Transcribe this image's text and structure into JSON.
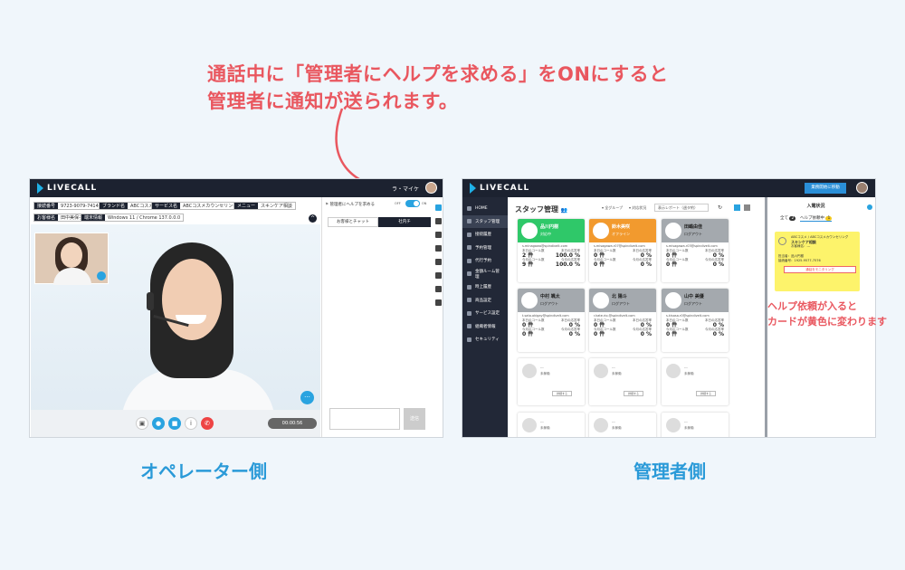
{
  "annotation": {
    "line1": "通話中に「管理者にヘルプを求める」をONにすると",
    "line2": "管理者に通知が送られます。",
    "side_line1": "ヘルプ依頼が入ると",
    "side_line2": "カードが黄色に変わります"
  },
  "labels": {
    "operator": "オペレーター側",
    "admin": "管理者側"
  },
  "app": {
    "logo": "LIVECALL",
    "accent": "#1fb0e6"
  },
  "operator": {
    "user_name": "ラ・マイケ",
    "tags": [
      {
        "k": "接続番号",
        "v": "9723-9079-7414"
      },
      {
        "k": "ブランド名",
        "v": "ABCコスメ"
      },
      {
        "k": "サービス名",
        "v": "ABCコスメカウンセリング"
      },
      {
        "k": "メニュー",
        "v": "スキンケア相談"
      },
      {
        "k": "お客様名",
        "v": "田中美保子"
      },
      {
        "k": "端末情報",
        "v": "Windows 11 / Chrome 137.0.0.0"
      }
    ],
    "help_label": "管理者にヘルプを求める",
    "toggle_off": "OFF",
    "toggle_on": "ON",
    "tab_chat": "お客様とチャット",
    "tab_internal": "社内チ",
    "send_label": "送信",
    "timer": "00:00:56"
  },
  "admin": {
    "top_button": "業務開始に移動",
    "title": "スタッフ管理",
    "filter_group": "全グループ",
    "filter_status": "対応状況",
    "filter_report": "表示レポート（週タ約）",
    "nav": [
      "HOME",
      "スタッフ管理",
      "接続履歴",
      "予約管理",
      "代行予約",
      "金額ルーム管理",
      "時上履歴",
      "商品設定",
      "サービス設定",
      "組織者情報",
      "セキュリティ"
    ],
    "cards": [
      {
        "name": "品川円樹",
        "status": "対応中",
        "color": "#2fc869",
        "email": "s.minagawa@spindivelt.com",
        "v1": "2 件",
        "v2": "100.0 %",
        "v3": "9 件",
        "v4": "100.0 %"
      },
      {
        "name": "鈴木美咲",
        "status": "オフライン",
        "color": "#f29a2e",
        "email": "s.misagawa.r07@spindivelt.com",
        "v1": "0 件",
        "v2": "0 %",
        "v3": "0 件",
        "v4": "0 %"
      },
      {
        "name": "田嶋由佳",
        "status": "ログアウト",
        "color": "#a4a9ae",
        "email": "s.misagawa.r03@spindivelt.com",
        "v1": "0 件",
        "v2": "0 %",
        "v3": "0 件",
        "v4": "0 %"
      },
      {
        "name": "中村 颯太",
        "status": "ログアウト",
        "color": "#a4a9ae",
        "email": "t.sato.okigay@spindivelt.com",
        "v1": "0 件",
        "v2": "0 %",
        "v3": "0 件",
        "v4": "0 %"
      },
      {
        "name": "北 陽斗",
        "status": "ログアウト",
        "color": "#a4a9ae",
        "email": "r.kate.rio.@spindivelt.com",
        "v1": "0 件",
        "v2": "0 %",
        "v3": "0 件",
        "v4": "0 %"
      },
      {
        "name": "山中 美優",
        "status": "ログアウト",
        "color": "#a4a9ae",
        "email": "s.kisasa.r0@spindivelt.com",
        "v1": "0 件",
        "v2": "0 %",
        "v3": "0 件",
        "v4": "0 %"
      }
    ],
    "card_label_calls": "本日のコール数",
    "card_label_rate": "本日の応答率",
    "card_label_calls_month": "今月のコール数",
    "card_label_rate_month": "今月の応答率",
    "empty_name": "---",
    "empty_status": "未稼働",
    "empty_button": "詳細する",
    "right_title": "入電状況",
    "right_tab_all": "全て",
    "right_tab_all_count": "2",
    "right_tab_help": "ヘルプ依頼中",
    "right_tab_help_count": "1",
    "help_card": {
      "line1": "ABCコスメ / ABCコスメカウンセリング",
      "line2": "スキンケア相談",
      "line3": "お客様名：---",
      "line4": "担当者：品川円樹",
      "line5": "接続番号：1925-9577-7576",
      "button": "通話をモニタリング",
      "bg": "#fdf36b"
    }
  }
}
